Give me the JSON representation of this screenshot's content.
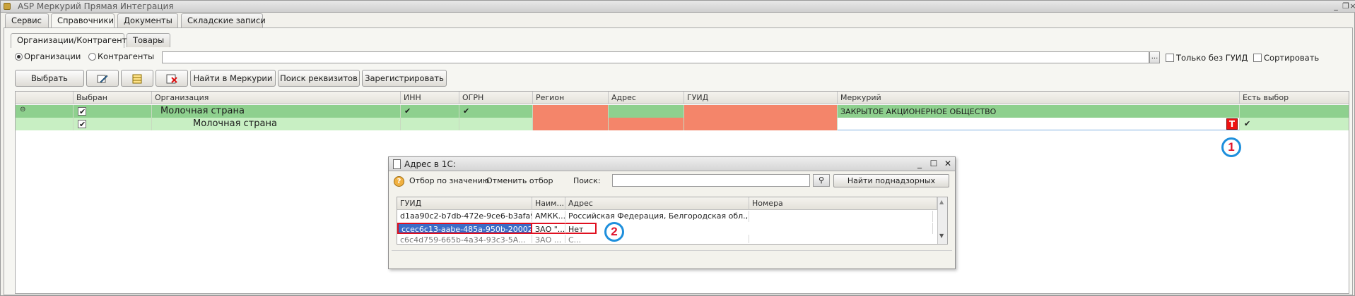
{
  "window": {
    "title": "ASP Меркурий Прямая Интеграция"
  },
  "top_tabs": [
    "Сервис",
    "Справочники",
    "Документы",
    "Складские записи"
  ],
  "sub_tabs": [
    "Организации/Контрагенты",
    "Товары"
  ],
  "filter": {
    "radio_orgs": "Организации",
    "radio_contragents": "Контрагенты",
    "dots": "...",
    "only_no_guid": "Только без ГУИД",
    "sort": "Сортировать"
  },
  "toolbar": {
    "select": "Выбрать",
    "find_mercury": "Найти в Меркурии",
    "search_requisites": "Поиск реквизитов",
    "register": "Зарегистрировать"
  },
  "grid": {
    "columns": [
      "Выбран",
      "Организация",
      "ИНН",
      "ОГРН",
      "Регион",
      "Адрес",
      "ГУИД",
      "Меркурий",
      "Есть выбор"
    ],
    "rows": [
      {
        "org": "Молочная страна",
        "mercury": "ЗАКРЫТОЕ АКЦИОНЕРНОЕ ОБЩЕСТВО",
        "tick": "✔"
      },
      {
        "org": "Молочная страна",
        "t_button": "T",
        "clear": "×",
        "tick": "✔"
      }
    ]
  },
  "markers": [
    "1",
    "2"
  ],
  "dialog": {
    "title": "Адрес в 1С:",
    "filter_by_value": "Отбор по значению",
    "cancel_filter": "Отменить отбор",
    "search_label": "Поиск:",
    "find_supervised": "Найти поднадзорных",
    "columns": [
      "ГУИД",
      "Наим...",
      "Адрес",
      "Номера"
    ],
    "rows": [
      {
        "guid": "d1aa90c2-b7db-472e-9ce6-b3afa99...",
        "name": "АМКК...",
        "address": "Российская Федерация, Белгородская обл., Ал..."
      },
      {
        "guid": "ccec6c13-aabe-485a-950b-20002c...",
        "name": "ЗАО \"...",
        "address": "Нет"
      },
      {
        "guid": "c6c4d759-665b-4a34-93c3-5A...",
        "name": "ЗАО ...",
        "address": "С..."
      }
    ]
  },
  "colors": {
    "highlight_row": "#8ed08e",
    "light_row": "#c8efc3",
    "error_cell": "#f4856a",
    "marker_border": "#1e8fdc",
    "marker_text": "#e0122b"
  }
}
